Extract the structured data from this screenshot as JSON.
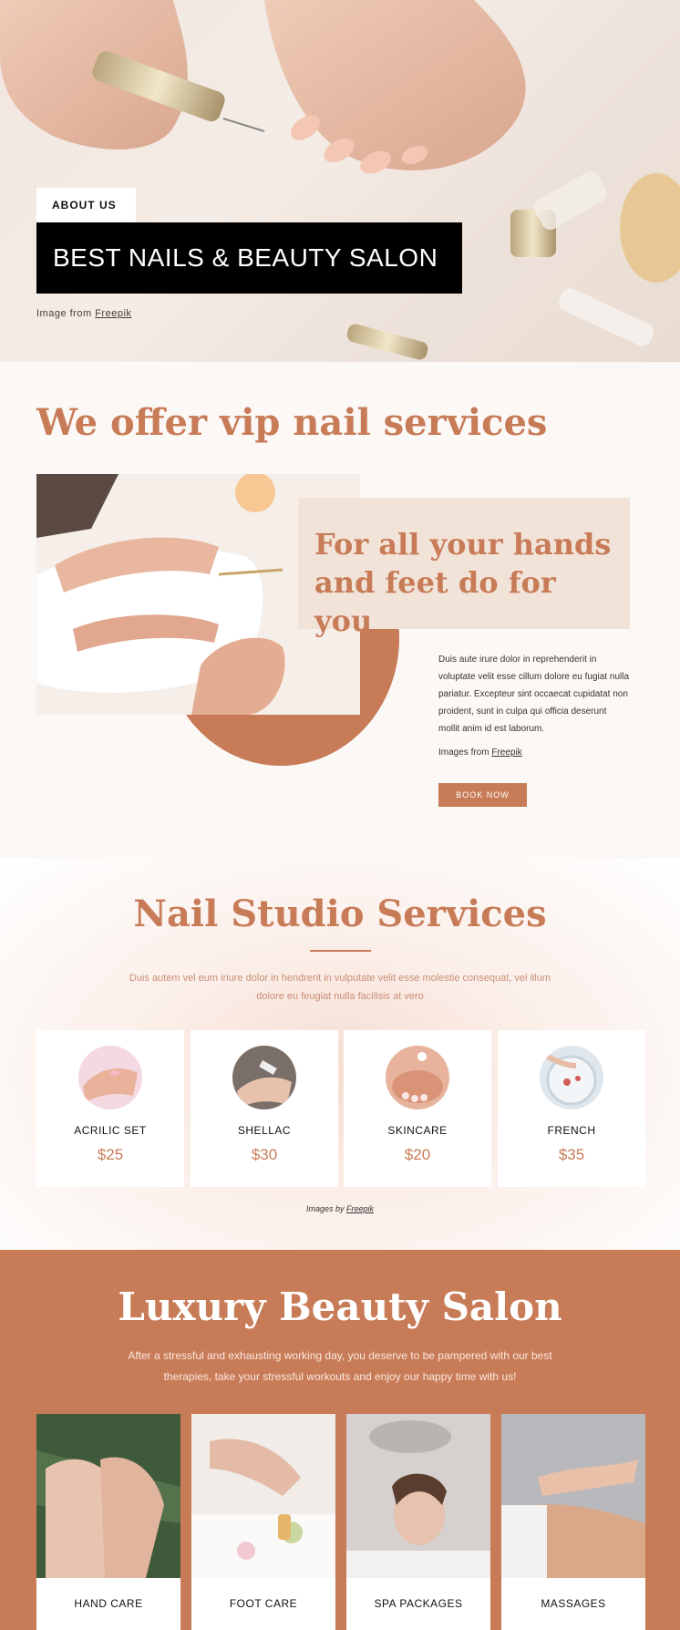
{
  "hero": {
    "tag": "ABOUT US",
    "title": "BEST NAILS & BEAUTY SALON",
    "credit_prefix": "Image from",
    "credit_link": "Freepik"
  },
  "vip": {
    "title": "We offer vip nail services",
    "card_title": "For all your hands and feet do for you",
    "paragraph": "Duis aute irure dolor in reprehenderit in voluptate velit esse cillum dolore eu fugiat nulla pariatur. Excepteur sint occaecat cupidatat non proident, sunt in culpa qui officia deserunt mollit anim id est laborum.",
    "credit_prefix": "Images from",
    "credit_link": "Freepik",
    "button": "BOOK NOW"
  },
  "studio": {
    "title": "Nail Studio Services",
    "subtitle": "Duis autem vel eum iriure dolor in hendrerit in vulputate velit esse molestie consequat, vel illum dolore eu feugiat nulla facilisis at vero",
    "services": [
      {
        "name": "ACRILIC SET",
        "price": "$25"
      },
      {
        "name": "SHELLAC",
        "price": "$30"
      },
      {
        "name": "SKINCARE",
        "price": "$20"
      },
      {
        "name": "FRENCH",
        "price": "$35"
      }
    ],
    "credit_prefix": "Images by",
    "credit_link": "Freepik"
  },
  "luxury": {
    "title": "Luxury Beauty Salon",
    "subtitle": "After a stressful and exhausting working day, you deserve to be pampered with our best therapies, take your stressful workouts and enjoy our happy time with us!",
    "cards": [
      {
        "label": "HAND CARE"
      },
      {
        "label": "FOOT CARE"
      },
      {
        "label": "SPA PACKAGES"
      },
      {
        "label": "MASSAGES"
      }
    ]
  },
  "colors": {
    "accent": "#c87b57",
    "card_bg": "#f2e3d8",
    "page_bg": "#fbf8f5"
  }
}
